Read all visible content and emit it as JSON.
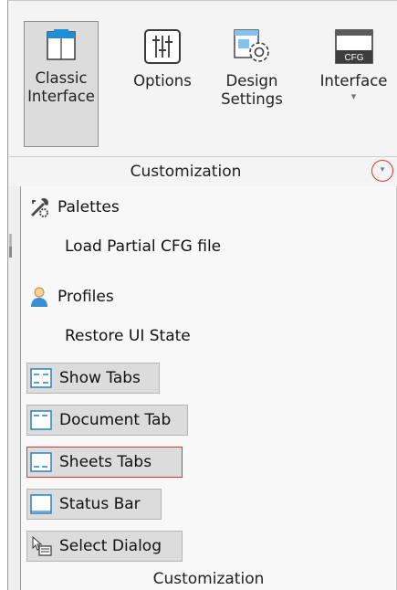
{
  "ribbon": {
    "buttons": [
      {
        "line1": "Classic",
        "line2": "Interface",
        "icon": "classic-interface-icon"
      },
      {
        "line1": "Options",
        "line2": "",
        "icon": "options-sliders-icon"
      },
      {
        "line1": "Design",
        "line2": "Settings",
        "icon": "design-settings-gear-icon"
      },
      {
        "line1": "Interface",
        "line2": "",
        "icon": "cfg-interface-icon",
        "icon_text": "CFG"
      }
    ],
    "panel_label": "Customization",
    "expander_glyph": "▾"
  },
  "menu": {
    "items": [
      {
        "label": "Palettes",
        "icon": "palettes-tools-icon"
      },
      {
        "label": "Load Partial CFG file",
        "icon": ""
      },
      {
        "label": "Profiles",
        "icon": "profiles-user-icon"
      },
      {
        "label": "Restore UI State",
        "icon": ""
      },
      {
        "label": "Show Tabs",
        "icon": "show-tabs-icon"
      },
      {
        "label": "Document Tab",
        "icon": "document-tab-icon"
      },
      {
        "label": "Sheets Tabs",
        "icon": "sheets-tabs-icon"
      },
      {
        "label": "Status Bar",
        "icon": "status-bar-icon"
      },
      {
        "label": "Select Dialog",
        "icon": "select-dialog-icon"
      }
    ],
    "footer_label": "Customization"
  },
  "colors": {
    "accent_blue": "#1e8fd6",
    "highlight_red": "#e23333",
    "checked_bg": "#dcdcdc"
  }
}
